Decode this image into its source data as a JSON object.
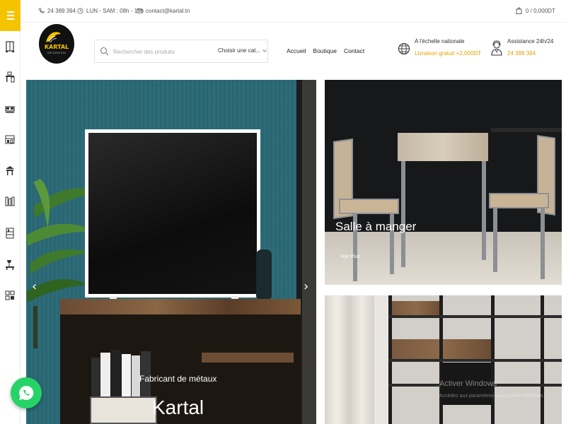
{
  "topbar": {
    "phone": "24 389 394",
    "hours": "LUN - SAM : 08h - 17h",
    "email": "contact@kartal.tn",
    "cart": "0 / 0,000DT"
  },
  "logo": {
    "brand": "KARTAL",
    "tagline": "DECORATION"
  },
  "search": {
    "placeholder": "Rechercher des produits",
    "category": "Choisir une cat..."
  },
  "nav": [
    "Accueil",
    "Boutique",
    "Contact"
  ],
  "info": {
    "delivery_title": "A l'échelle nationale",
    "delivery_sub": "Livraison gratuit +2,000DT",
    "support_title": "Assistance 24h/24",
    "support_phone": "24 389 394"
  },
  "hero": {
    "subtitle": "Fabricant de métaux",
    "title": "Kartal",
    "prev_arrow": "‹",
    "next_arrow": "›"
  },
  "card_dining": {
    "title": "Salle à manger",
    "link": "Voir Plus"
  },
  "card_living": {
    "faded_title": "Activer Windows",
    "faded_sub": "Accédez aux paramètres pour activer Windows."
  },
  "colors": {
    "accent": "#f5c400",
    "price": "#e3a200",
    "whatsapp": "#25d366"
  },
  "rail_icons": [
    "menu-icon",
    "bedroom-icon",
    "office-icon",
    "bed-icon",
    "kitchen-icon",
    "dining-icon",
    "furniture-icon",
    "storage-icon",
    "living-icon",
    "kids-icon"
  ]
}
